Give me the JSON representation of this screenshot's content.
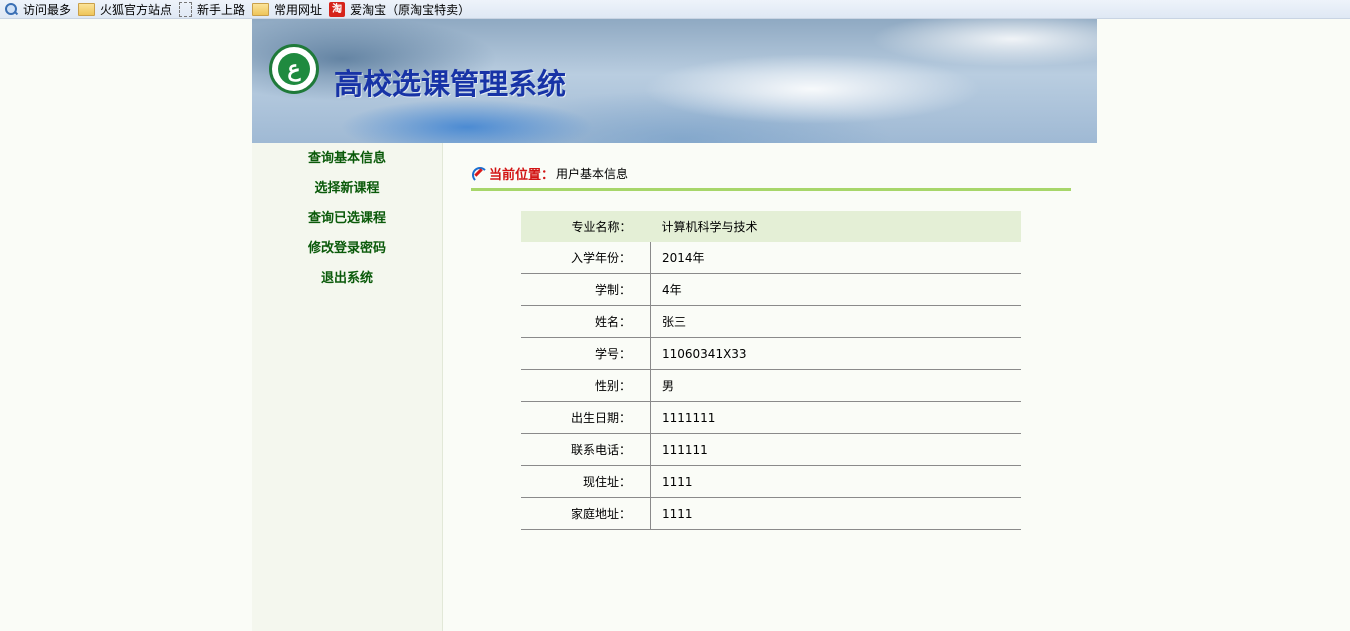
{
  "bookmarks": [
    {
      "icon": "search-icon",
      "label": "访问最多"
    },
    {
      "icon": "folder-icon",
      "label": "火狐官方站点"
    },
    {
      "icon": "page-icon",
      "label": "新手上路"
    },
    {
      "icon": "folder-icon",
      "label": "常用网址"
    },
    {
      "icon": "taobao-icon",
      "label": "爱淘宝（原淘宝特卖）"
    }
  ],
  "banner": {
    "title": "高校选课管理系统"
  },
  "nav": {
    "items": [
      {
        "label": "查询基本信息"
      },
      {
        "label": "选择新课程"
      },
      {
        "label": "查询已选课程"
      },
      {
        "label": "修改登录密码"
      },
      {
        "label": "退出系统"
      }
    ]
  },
  "breadcrumb": {
    "label": "当前位置：",
    "value": "用户基本信息"
  },
  "info": {
    "rows": [
      {
        "key": "专业名称：",
        "value": "计算机科学与技术"
      },
      {
        "key": "入学年份：",
        "value": "2014年"
      },
      {
        "key": "学制：",
        "value": "4年"
      },
      {
        "key": "姓名：",
        "value": "张三"
      },
      {
        "key": "学号：",
        "value": "11060341X33"
      },
      {
        "key": "性别：",
        "value": "男"
      },
      {
        "key": "出生日期：",
        "value": "1111111"
      },
      {
        "key": "联系电话：",
        "value": "111111"
      },
      {
        "key": "现住址：",
        "value": "1111"
      },
      {
        "key": "家庭地址：",
        "value": "1111"
      }
    ]
  },
  "colors": {
    "title": "#1733a6",
    "nav_text": "#0a5a0a",
    "crumb_label": "#d21414",
    "crumb_rule": "#a7d66a",
    "first_row_bg": "#e4efd6"
  }
}
